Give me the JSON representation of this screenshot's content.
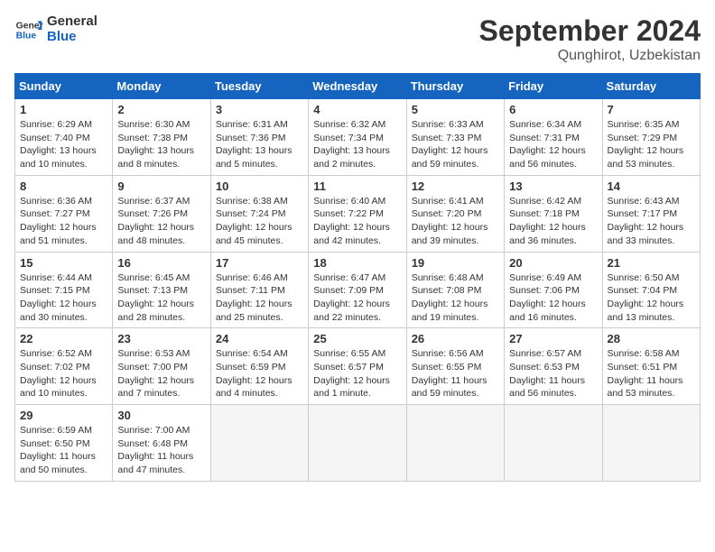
{
  "header": {
    "logo_line1": "General",
    "logo_line2": "Blue",
    "month": "September 2024",
    "location": "Qunghirot, Uzbekistan"
  },
  "weekdays": [
    "Sunday",
    "Monday",
    "Tuesday",
    "Wednesday",
    "Thursday",
    "Friday",
    "Saturday"
  ],
  "weeks": [
    [
      {
        "day": "1",
        "info": "Sunrise: 6:29 AM\nSunset: 7:40 PM\nDaylight: 13 hours\nand 10 minutes."
      },
      {
        "day": "2",
        "info": "Sunrise: 6:30 AM\nSunset: 7:38 PM\nDaylight: 13 hours\nand 8 minutes."
      },
      {
        "day": "3",
        "info": "Sunrise: 6:31 AM\nSunset: 7:36 PM\nDaylight: 13 hours\nand 5 minutes."
      },
      {
        "day": "4",
        "info": "Sunrise: 6:32 AM\nSunset: 7:34 PM\nDaylight: 13 hours\nand 2 minutes."
      },
      {
        "day": "5",
        "info": "Sunrise: 6:33 AM\nSunset: 7:33 PM\nDaylight: 12 hours\nand 59 minutes."
      },
      {
        "day": "6",
        "info": "Sunrise: 6:34 AM\nSunset: 7:31 PM\nDaylight: 12 hours\nand 56 minutes."
      },
      {
        "day": "7",
        "info": "Sunrise: 6:35 AM\nSunset: 7:29 PM\nDaylight: 12 hours\nand 53 minutes."
      }
    ],
    [
      {
        "day": "8",
        "info": "Sunrise: 6:36 AM\nSunset: 7:27 PM\nDaylight: 12 hours\nand 51 minutes."
      },
      {
        "day": "9",
        "info": "Sunrise: 6:37 AM\nSunset: 7:26 PM\nDaylight: 12 hours\nand 48 minutes."
      },
      {
        "day": "10",
        "info": "Sunrise: 6:38 AM\nSunset: 7:24 PM\nDaylight: 12 hours\nand 45 minutes."
      },
      {
        "day": "11",
        "info": "Sunrise: 6:40 AM\nSunset: 7:22 PM\nDaylight: 12 hours\nand 42 minutes."
      },
      {
        "day": "12",
        "info": "Sunrise: 6:41 AM\nSunset: 7:20 PM\nDaylight: 12 hours\nand 39 minutes."
      },
      {
        "day": "13",
        "info": "Sunrise: 6:42 AM\nSunset: 7:18 PM\nDaylight: 12 hours\nand 36 minutes."
      },
      {
        "day": "14",
        "info": "Sunrise: 6:43 AM\nSunset: 7:17 PM\nDaylight: 12 hours\nand 33 minutes."
      }
    ],
    [
      {
        "day": "15",
        "info": "Sunrise: 6:44 AM\nSunset: 7:15 PM\nDaylight: 12 hours\nand 30 minutes."
      },
      {
        "day": "16",
        "info": "Sunrise: 6:45 AM\nSunset: 7:13 PM\nDaylight: 12 hours\nand 28 minutes."
      },
      {
        "day": "17",
        "info": "Sunrise: 6:46 AM\nSunset: 7:11 PM\nDaylight: 12 hours\nand 25 minutes."
      },
      {
        "day": "18",
        "info": "Sunrise: 6:47 AM\nSunset: 7:09 PM\nDaylight: 12 hours\nand 22 minutes."
      },
      {
        "day": "19",
        "info": "Sunrise: 6:48 AM\nSunset: 7:08 PM\nDaylight: 12 hours\nand 19 minutes."
      },
      {
        "day": "20",
        "info": "Sunrise: 6:49 AM\nSunset: 7:06 PM\nDaylight: 12 hours\nand 16 minutes."
      },
      {
        "day": "21",
        "info": "Sunrise: 6:50 AM\nSunset: 7:04 PM\nDaylight: 12 hours\nand 13 minutes."
      }
    ],
    [
      {
        "day": "22",
        "info": "Sunrise: 6:52 AM\nSunset: 7:02 PM\nDaylight: 12 hours\nand 10 minutes."
      },
      {
        "day": "23",
        "info": "Sunrise: 6:53 AM\nSunset: 7:00 PM\nDaylight: 12 hours\nand 7 minutes."
      },
      {
        "day": "24",
        "info": "Sunrise: 6:54 AM\nSunset: 6:59 PM\nDaylight: 12 hours\nand 4 minutes."
      },
      {
        "day": "25",
        "info": "Sunrise: 6:55 AM\nSunset: 6:57 PM\nDaylight: 12 hours\nand 1 minute."
      },
      {
        "day": "26",
        "info": "Sunrise: 6:56 AM\nSunset: 6:55 PM\nDaylight: 11 hours\nand 59 minutes."
      },
      {
        "day": "27",
        "info": "Sunrise: 6:57 AM\nSunset: 6:53 PM\nDaylight: 11 hours\nand 56 minutes."
      },
      {
        "day": "28",
        "info": "Sunrise: 6:58 AM\nSunset: 6:51 PM\nDaylight: 11 hours\nand 53 minutes."
      }
    ],
    [
      {
        "day": "29",
        "info": "Sunrise: 6:59 AM\nSunset: 6:50 PM\nDaylight: 11 hours\nand 50 minutes."
      },
      {
        "day": "30",
        "info": "Sunrise: 7:00 AM\nSunset: 6:48 PM\nDaylight: 11 hours\nand 47 minutes."
      },
      null,
      null,
      null,
      null,
      null
    ]
  ]
}
